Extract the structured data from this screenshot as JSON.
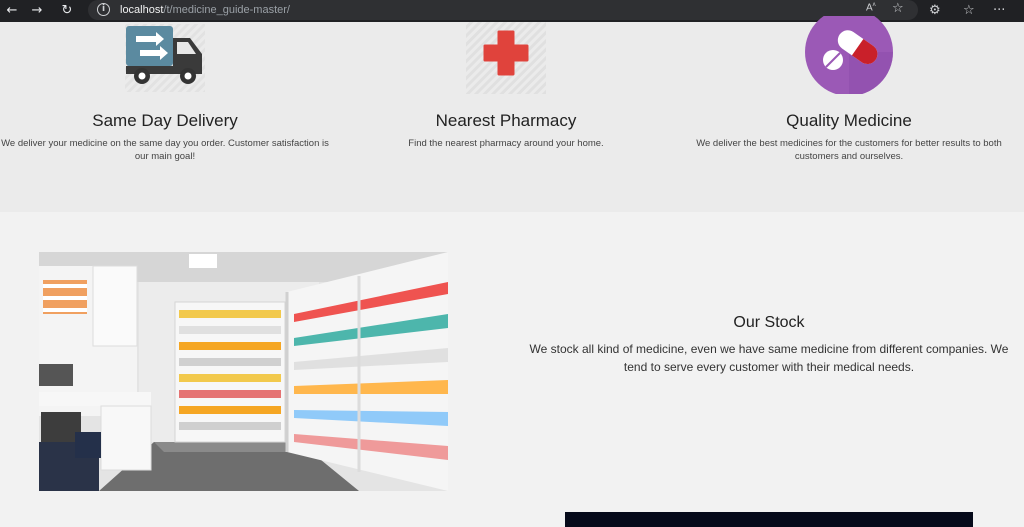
{
  "browser": {
    "url_host": "localhost",
    "url_path": "/t/medicine_guide-master/",
    "icons": [
      "back-arrow-icon",
      "forward-arrow-icon",
      "reload-icon",
      "site-info-icon",
      "read-aloud-icon",
      "favorite-star-icon",
      "extensions-icon",
      "favorites-collection-icon",
      "more-menu-icon"
    ]
  },
  "features": [
    {
      "icon": "delivery-truck-icon",
      "title": "Same Day Delivery",
      "text": "We deliver your medicine on the same day you order. Customer satisfaction is our main goal!"
    },
    {
      "icon": "pharmacy-cross-icon",
      "title": "Nearest Pharmacy",
      "text": "Find the nearest pharmacy around your home."
    },
    {
      "icon": "capsule-pill-icon",
      "title": "Quality Medicine",
      "text": "We deliver the best medicines for the customers for better results to both customers and ourselves."
    }
  ],
  "stock": {
    "title": "Our Stock",
    "text": "We stock all kind of medicine, even we have same medicine from different companies. We tend to serve every customer with their medical needs."
  },
  "colors": {
    "chrome_bg": "#202124",
    "features_bg": "#ebebeb",
    "stock_bg": "#f2f2f2",
    "cross_red": "#e0433c",
    "pill_purple": "#9b59b6",
    "truck_blue": "#5b8aa0"
  }
}
